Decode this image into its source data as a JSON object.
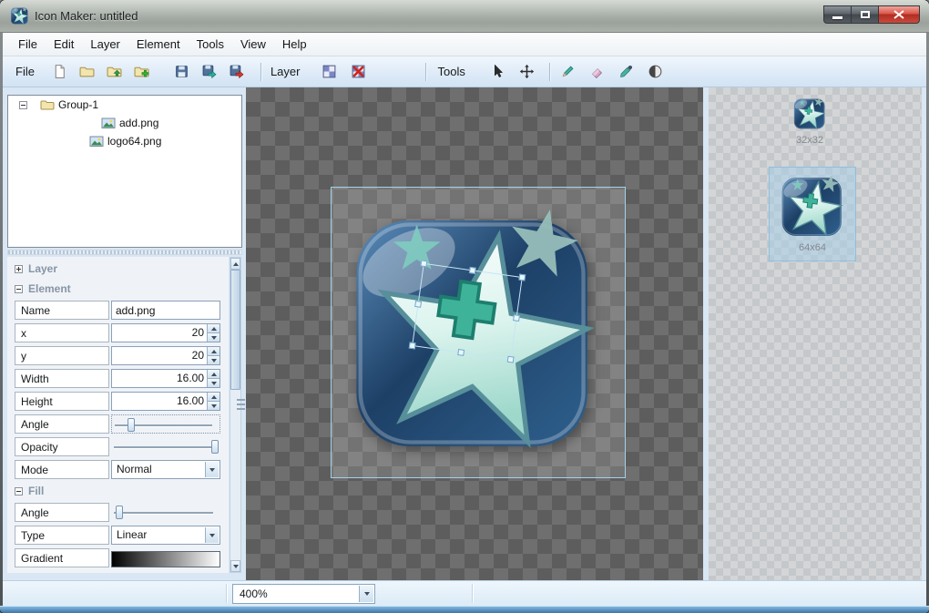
{
  "window": {
    "title": "Icon Maker: untitled"
  },
  "menu": {
    "items": [
      "File",
      "Edit",
      "Layer",
      "Element",
      "Tools",
      "View",
      "Help"
    ]
  },
  "toolbar": {
    "file_label": "File",
    "layer_label": "Layer",
    "tools_label": "Tools"
  },
  "tree": {
    "items": [
      {
        "label": "Group-1",
        "type": "group"
      },
      {
        "label": "add.png",
        "type": "image"
      },
      {
        "label": "logo64.png",
        "type": "image"
      }
    ]
  },
  "properties": {
    "layer_title": "Layer",
    "element_title": "Element",
    "fill_title": "Fill",
    "name": {
      "label": "Name",
      "value": "add.png"
    },
    "x": {
      "label": "x",
      "value": "20"
    },
    "y": {
      "label": "y",
      "value": "20"
    },
    "width": {
      "label": "Width",
      "value": "16.00"
    },
    "height": {
      "label": "Height",
      "value": "16.00"
    },
    "angle": {
      "label": "Angle"
    },
    "opacity": {
      "label": "Opacity"
    },
    "mode": {
      "label": "Mode",
      "value": "Normal"
    },
    "fill_angle": {
      "label": "Angle"
    },
    "fill_type": {
      "label": "Type",
      "value": "Linear"
    },
    "gradient": {
      "label": "Gradient"
    }
  },
  "previews": {
    "small": {
      "label": "32x32"
    },
    "large": {
      "label": "64x64"
    }
  },
  "statusbar": {
    "zoom": "400%"
  },
  "colors": {
    "selection_border": "#a3d2ea",
    "icon_blue": "#1e4468",
    "star_teal": "#bfeee4",
    "cross_green": "#3fb29a",
    "close_red": "#b12d22"
  }
}
